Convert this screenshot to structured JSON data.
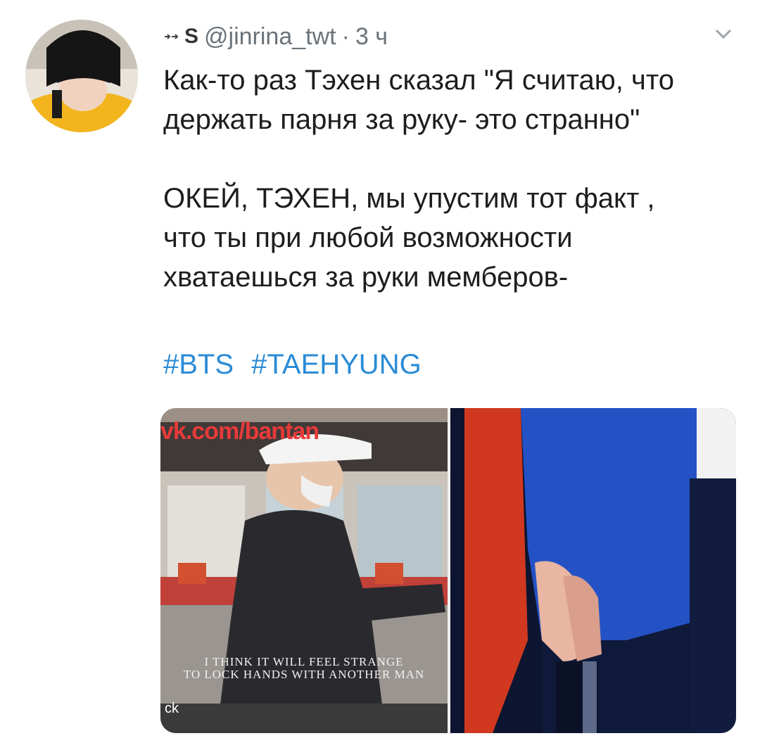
{
  "tweet": {
    "name": "S",
    "handle": "@jinrina_twt",
    "separator": "·",
    "time": "3 ч",
    "text_lines_1": [
      "Как-то раз Тэхен сказал \"Я считаю, что",
      "держать парня за руку- это странно\""
    ],
    "text_lines_2": [
      "ОКЕЙ, ТЭХЕН, мы упустим тот факт ,",
      "что ты при любой возможности",
      "хватаешься за руки мемберов-"
    ],
    "hashtags": [
      "#BTS",
      "#TAEHYUNG"
    ]
  },
  "media": {
    "watermark": "vk.com/bantan",
    "subtitle_line1": "I THINK IT WILL FEEL STRANGE",
    "subtitle_line2": "TO LOCK HANDS WITH ANOTHER MAN",
    "corner_text": "ck"
  },
  "icons": {
    "retweet": "retweet-icon",
    "chevron": "chevron-down-icon"
  },
  "colors": {
    "hashtag": "#2a8bd6",
    "meta": "#6b737a"
  }
}
